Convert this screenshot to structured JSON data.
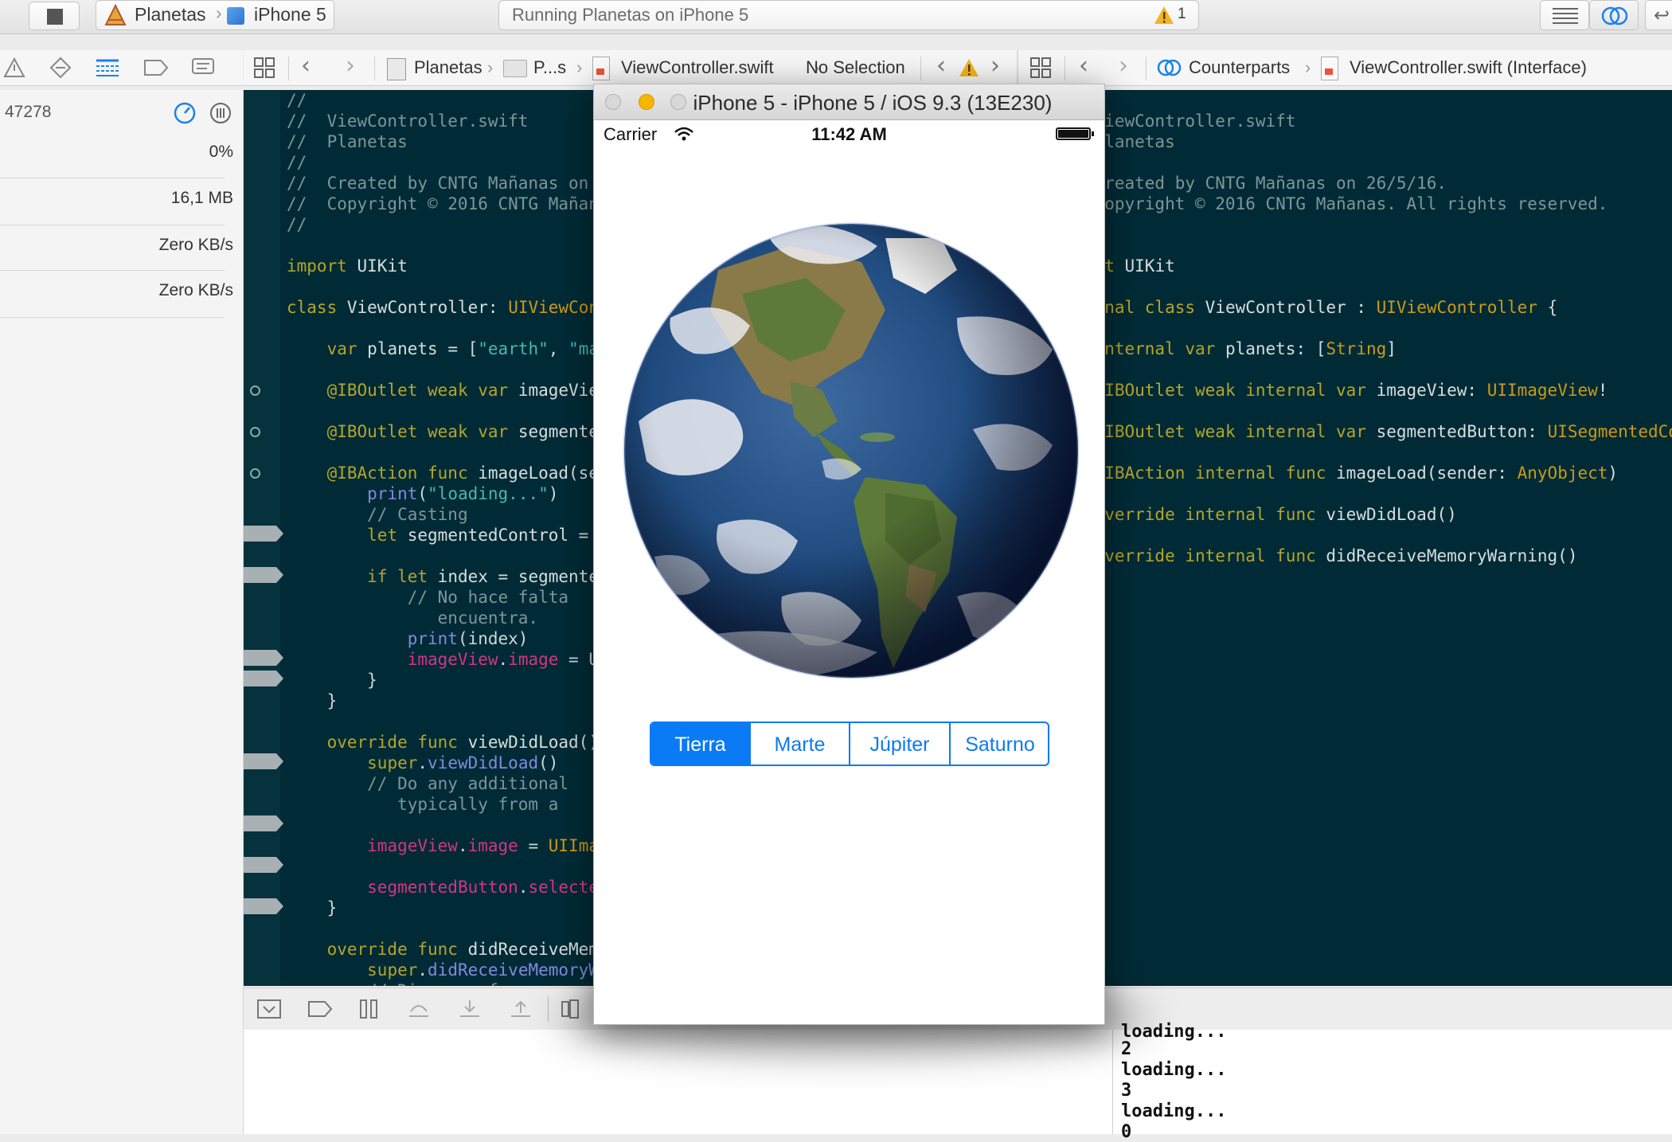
{
  "toolbar": {
    "scheme_project": "Planetas",
    "scheme_device": "iPhone 5",
    "activity_status": "Running Planetas on iPhone 5",
    "warning_count": "1"
  },
  "left_jumpbar": {
    "path": [
      "Planetas",
      "P...s",
      "ViewController.swift",
      "No Selection"
    ]
  },
  "right_jumpbar": {
    "mode": "Counterparts",
    "file": "ViewController.swift (Interface)"
  },
  "debug_navigator": {
    "pid": "47278",
    "cpu": "0%",
    "memory": "16,1 MB",
    "disk": "Zero KB/s",
    "network": "Zero KB/s"
  },
  "simulator": {
    "window_title": "iPhone 5 - iPhone 5 / iOS 9.3 (13E230)",
    "status_bar": {
      "carrier": "Carrier",
      "time": "11:42 AM"
    },
    "image_description": "earth",
    "segmented_control": {
      "segments": [
        "Tierra",
        "Marte",
        "Júpiter",
        "Saturno"
      ],
      "selected_index": 0
    }
  },
  "console_output": [
    "loading...",
    "2",
    "loading...",
    "3",
    "loading...",
    "0"
  ],
  "colors": {
    "editor_background": "#002b36",
    "ios_tint": "#0b7af5",
    "keyword": "#b5a52a",
    "type": "#cb9a16",
    "string": "#4ab8b0",
    "property": "#d33682",
    "comment": "#7f959a"
  }
}
